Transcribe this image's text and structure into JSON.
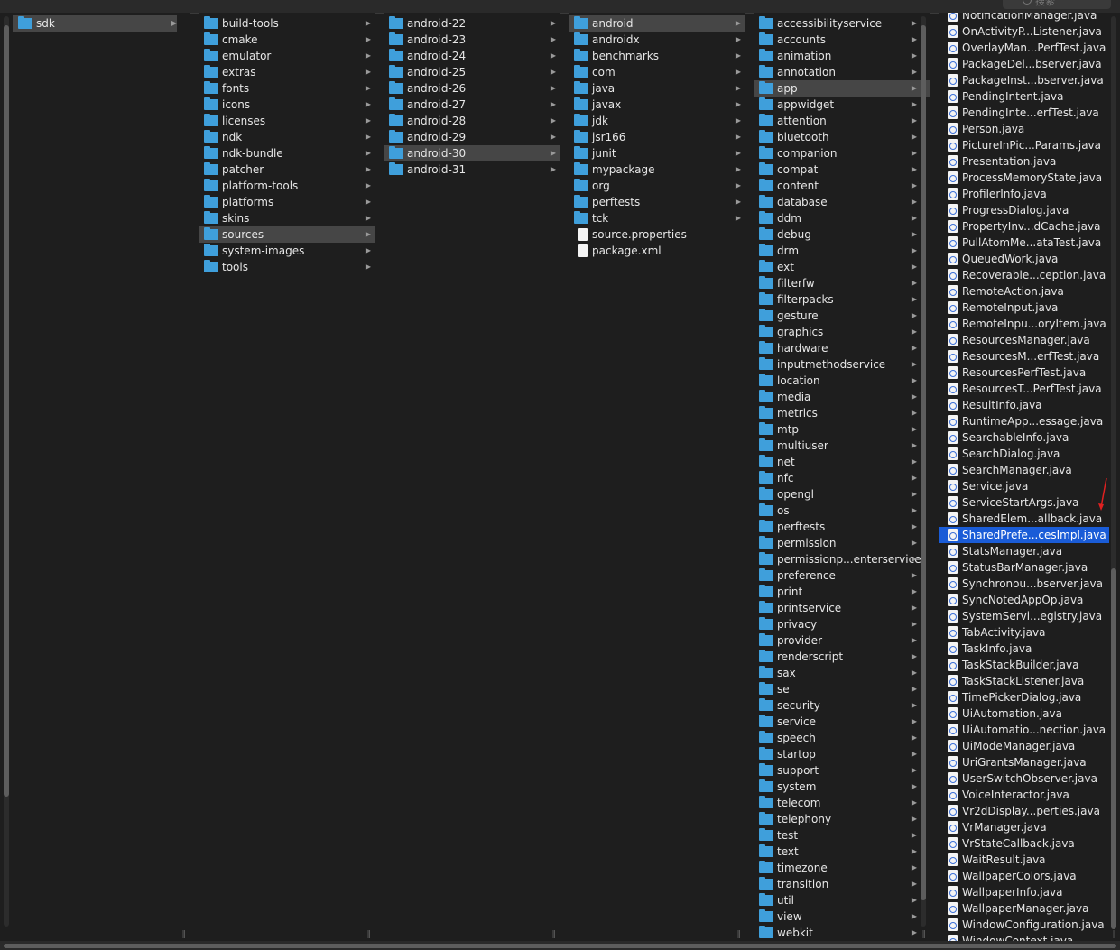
{
  "search": {
    "placeholder": "搜索"
  },
  "columns": [
    {
      "id": "c1",
      "selected": 0,
      "selected_style": "gray",
      "items": [
        {
          "name": "sdk",
          "kind": "folder"
        }
      ]
    },
    {
      "id": "c2",
      "selected": 13,
      "selected_style": "gray",
      "items": [
        {
          "name": "build-tools",
          "kind": "folder"
        },
        {
          "name": "cmake",
          "kind": "folder"
        },
        {
          "name": "emulator",
          "kind": "folder"
        },
        {
          "name": "extras",
          "kind": "folder"
        },
        {
          "name": "fonts",
          "kind": "folder"
        },
        {
          "name": "icons",
          "kind": "folder"
        },
        {
          "name": "licenses",
          "kind": "folder"
        },
        {
          "name": "ndk",
          "kind": "folder"
        },
        {
          "name": "ndk-bundle",
          "kind": "folder"
        },
        {
          "name": "patcher",
          "kind": "folder"
        },
        {
          "name": "platform-tools",
          "kind": "folder"
        },
        {
          "name": "platforms",
          "kind": "folder"
        },
        {
          "name": "skins",
          "kind": "folder"
        },
        {
          "name": "sources",
          "kind": "folder"
        },
        {
          "name": "system-images",
          "kind": "folder"
        },
        {
          "name": "tools",
          "kind": "folder"
        }
      ]
    },
    {
      "id": "c3",
      "selected": 8,
      "selected_style": "gray",
      "items": [
        {
          "name": "android-22",
          "kind": "folder"
        },
        {
          "name": "android-23",
          "kind": "folder"
        },
        {
          "name": "android-24",
          "kind": "folder"
        },
        {
          "name": "android-25",
          "kind": "folder"
        },
        {
          "name": "android-26",
          "kind": "folder"
        },
        {
          "name": "android-27",
          "kind": "folder"
        },
        {
          "name": "android-28",
          "kind": "folder"
        },
        {
          "name": "android-29",
          "kind": "folder"
        },
        {
          "name": "android-30",
          "kind": "folder"
        },
        {
          "name": "android-31",
          "kind": "folder"
        }
      ]
    },
    {
      "id": "c4",
      "selected": 0,
      "selected_style": "gray",
      "items": [
        {
          "name": "android",
          "kind": "folder"
        },
        {
          "name": "androidx",
          "kind": "folder"
        },
        {
          "name": "benchmarks",
          "kind": "folder"
        },
        {
          "name": "com",
          "kind": "folder"
        },
        {
          "name": "java",
          "kind": "folder"
        },
        {
          "name": "javax",
          "kind": "folder"
        },
        {
          "name": "jdk",
          "kind": "folder"
        },
        {
          "name": "jsr166",
          "kind": "folder"
        },
        {
          "name": "junit",
          "kind": "folder"
        },
        {
          "name": "mypackage",
          "kind": "folder"
        },
        {
          "name": "org",
          "kind": "folder"
        },
        {
          "name": "perftests",
          "kind": "folder"
        },
        {
          "name": "tck",
          "kind": "folder"
        },
        {
          "name": "source.properties",
          "kind": "file"
        },
        {
          "name": "package.xml",
          "kind": "file"
        }
      ]
    },
    {
      "id": "c5",
      "selected": 4,
      "selected_style": "gray",
      "items": [
        {
          "name": "accessibilityservice",
          "kind": "folder"
        },
        {
          "name": "accounts",
          "kind": "folder"
        },
        {
          "name": "animation",
          "kind": "folder"
        },
        {
          "name": "annotation",
          "kind": "folder"
        },
        {
          "name": "app",
          "kind": "folder"
        },
        {
          "name": "appwidget",
          "kind": "folder"
        },
        {
          "name": "attention",
          "kind": "folder"
        },
        {
          "name": "bluetooth",
          "kind": "folder"
        },
        {
          "name": "companion",
          "kind": "folder"
        },
        {
          "name": "compat",
          "kind": "folder"
        },
        {
          "name": "content",
          "kind": "folder"
        },
        {
          "name": "database",
          "kind": "folder"
        },
        {
          "name": "ddm",
          "kind": "folder"
        },
        {
          "name": "debug",
          "kind": "folder"
        },
        {
          "name": "drm",
          "kind": "folder"
        },
        {
          "name": "ext",
          "kind": "folder"
        },
        {
          "name": "filterfw",
          "kind": "folder"
        },
        {
          "name": "filterpacks",
          "kind": "folder"
        },
        {
          "name": "gesture",
          "kind": "folder"
        },
        {
          "name": "graphics",
          "kind": "folder"
        },
        {
          "name": "hardware",
          "kind": "folder"
        },
        {
          "name": "inputmethodservice",
          "kind": "folder"
        },
        {
          "name": "location",
          "kind": "folder"
        },
        {
          "name": "media",
          "kind": "folder"
        },
        {
          "name": "metrics",
          "kind": "folder"
        },
        {
          "name": "mtp",
          "kind": "folder"
        },
        {
          "name": "multiuser",
          "kind": "folder"
        },
        {
          "name": "net",
          "kind": "folder"
        },
        {
          "name": "nfc",
          "kind": "folder"
        },
        {
          "name": "opengl",
          "kind": "folder"
        },
        {
          "name": "os",
          "kind": "folder"
        },
        {
          "name": "perftests",
          "kind": "folder"
        },
        {
          "name": "permission",
          "kind": "folder"
        },
        {
          "name": "permissionp...enterservice",
          "kind": "folder"
        },
        {
          "name": "preference",
          "kind": "folder"
        },
        {
          "name": "print",
          "kind": "folder"
        },
        {
          "name": "printservice",
          "kind": "folder"
        },
        {
          "name": "privacy",
          "kind": "folder"
        },
        {
          "name": "provider",
          "kind": "folder"
        },
        {
          "name": "renderscript",
          "kind": "folder"
        },
        {
          "name": "sax",
          "kind": "folder"
        },
        {
          "name": "se",
          "kind": "folder"
        },
        {
          "name": "security",
          "kind": "folder"
        },
        {
          "name": "service",
          "kind": "folder"
        },
        {
          "name": "speech",
          "kind": "folder"
        },
        {
          "name": "startop",
          "kind": "folder"
        },
        {
          "name": "support",
          "kind": "folder"
        },
        {
          "name": "system",
          "kind": "folder"
        },
        {
          "name": "telecom",
          "kind": "folder"
        },
        {
          "name": "telephony",
          "kind": "folder"
        },
        {
          "name": "test",
          "kind": "folder"
        },
        {
          "name": "text",
          "kind": "folder"
        },
        {
          "name": "timezone",
          "kind": "folder"
        },
        {
          "name": "transition",
          "kind": "folder"
        },
        {
          "name": "util",
          "kind": "folder"
        },
        {
          "name": "view",
          "kind": "folder"
        },
        {
          "name": "webkit",
          "kind": "folder"
        }
      ]
    },
    {
      "id": "c6",
      "selected": 32,
      "selected_style": "blue",
      "items": [
        {
          "name": "NotificationManager.java",
          "kind": "java"
        },
        {
          "name": "OnActivityP...Listener.java",
          "kind": "java"
        },
        {
          "name": "OverlayMan...PerfTest.java",
          "kind": "java"
        },
        {
          "name": "PackageDel...bserver.java",
          "kind": "java"
        },
        {
          "name": "PackageInst...bserver.java",
          "kind": "java"
        },
        {
          "name": "PendingIntent.java",
          "kind": "java"
        },
        {
          "name": "PendingInte...erfTest.java",
          "kind": "java"
        },
        {
          "name": "Person.java",
          "kind": "java"
        },
        {
          "name": "PictureInPic...Params.java",
          "kind": "java"
        },
        {
          "name": "Presentation.java",
          "kind": "java"
        },
        {
          "name": "ProcessMemoryState.java",
          "kind": "java"
        },
        {
          "name": "ProfilerInfo.java",
          "kind": "java"
        },
        {
          "name": "ProgressDialog.java",
          "kind": "java"
        },
        {
          "name": "PropertyInv...dCache.java",
          "kind": "java"
        },
        {
          "name": "PullAtomMe...ataTest.java",
          "kind": "java"
        },
        {
          "name": "QueuedWork.java",
          "kind": "java"
        },
        {
          "name": "Recoverable...ception.java",
          "kind": "java"
        },
        {
          "name": "RemoteAction.java",
          "kind": "java"
        },
        {
          "name": "RemoteInput.java",
          "kind": "java"
        },
        {
          "name": "RemoteInpu...oryItem.java",
          "kind": "java"
        },
        {
          "name": "ResourcesManager.java",
          "kind": "java"
        },
        {
          "name": "ResourcesM...erfTest.java",
          "kind": "java"
        },
        {
          "name": "ResourcesPerfTest.java",
          "kind": "java"
        },
        {
          "name": "ResourcesT...PerfTest.java",
          "kind": "java"
        },
        {
          "name": "ResultInfo.java",
          "kind": "java"
        },
        {
          "name": "RuntimeApp...essage.java",
          "kind": "java"
        },
        {
          "name": "SearchableInfo.java",
          "kind": "java"
        },
        {
          "name": "SearchDialog.java",
          "kind": "java"
        },
        {
          "name": "SearchManager.java",
          "kind": "java"
        },
        {
          "name": "Service.java",
          "kind": "java"
        },
        {
          "name": "ServiceStartArgs.java",
          "kind": "java"
        },
        {
          "name": "SharedElem...allback.java",
          "kind": "java"
        },
        {
          "name": "SharedPrefe...cesImpl.java",
          "kind": "java"
        },
        {
          "name": "StatsManager.java",
          "kind": "java"
        },
        {
          "name": "StatusBarManager.java",
          "kind": "java"
        },
        {
          "name": "Synchronou...bserver.java",
          "kind": "java"
        },
        {
          "name": "SyncNotedAppOp.java",
          "kind": "java"
        },
        {
          "name": "SystemServi...egistry.java",
          "kind": "java"
        },
        {
          "name": "TabActivity.java",
          "kind": "java"
        },
        {
          "name": "TaskInfo.java",
          "kind": "java"
        },
        {
          "name": "TaskStackBuilder.java",
          "kind": "java"
        },
        {
          "name": "TaskStackListener.java",
          "kind": "java"
        },
        {
          "name": "TimePickerDialog.java",
          "kind": "java"
        },
        {
          "name": "UiAutomation.java",
          "kind": "java"
        },
        {
          "name": "UiAutomatio...nection.java",
          "kind": "java"
        },
        {
          "name": "UiModeManager.java",
          "kind": "java"
        },
        {
          "name": "UriGrantsManager.java",
          "kind": "java"
        },
        {
          "name": "UserSwitchObserver.java",
          "kind": "java"
        },
        {
          "name": "VoiceInteractor.java",
          "kind": "java"
        },
        {
          "name": "Vr2dDisplay...perties.java",
          "kind": "java"
        },
        {
          "name": "VrManager.java",
          "kind": "java"
        },
        {
          "name": "VrStateCallback.java",
          "kind": "java"
        },
        {
          "name": "WaitResult.java",
          "kind": "java"
        },
        {
          "name": "WallpaperColors.java",
          "kind": "java"
        },
        {
          "name": "WallpaperInfo.java",
          "kind": "java"
        },
        {
          "name": "WallpaperManager.java",
          "kind": "java"
        },
        {
          "name": "WindowConfiguration.java",
          "kind": "java"
        },
        {
          "name": "WindowContext.java",
          "kind": "java"
        }
      ]
    }
  ],
  "colors": {
    "selected_gray": "#464646",
    "selected_blue": "#1a5cd7",
    "folder": "#3f9fdb",
    "annotation": "#e02020"
  }
}
